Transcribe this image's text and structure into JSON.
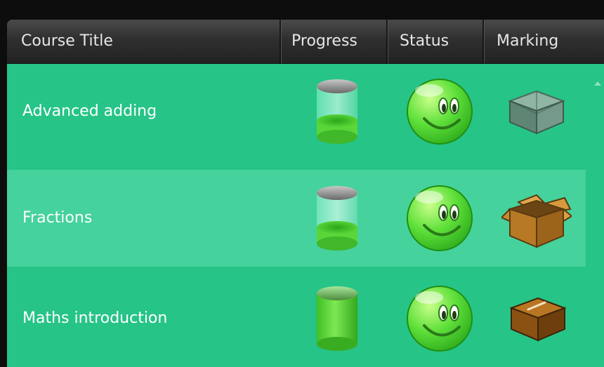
{
  "table": {
    "columns": {
      "title": "Course Title",
      "progress": "Progress",
      "status": "Status",
      "marking": "Marking"
    },
    "rows": [
      {
        "title": "Advanced adding",
        "progress": 0.25,
        "progress_icon": "cylinder-partially-filled-icon",
        "status_icon": "smiley-face-icon",
        "marking_icon": "empty-transparent-box-icon"
      },
      {
        "title": "Fractions",
        "progress": 0.25,
        "progress_icon": "cylinder-partially-filled-icon",
        "status_icon": "smiley-face-icon",
        "marking_icon": "open-cardboard-box-icon"
      },
      {
        "title": "Maths introduction",
        "progress": 1,
        "progress_icon": "cylinder-full-icon",
        "status_icon": "smiley-face-icon",
        "marking_icon": "closed-cardboard-box-icon"
      }
    ]
  },
  "colors": {
    "background": "#0d0d0d",
    "row": "#26c487",
    "row_highlight": "#45d29c",
    "header": "#2f2f2f"
  }
}
